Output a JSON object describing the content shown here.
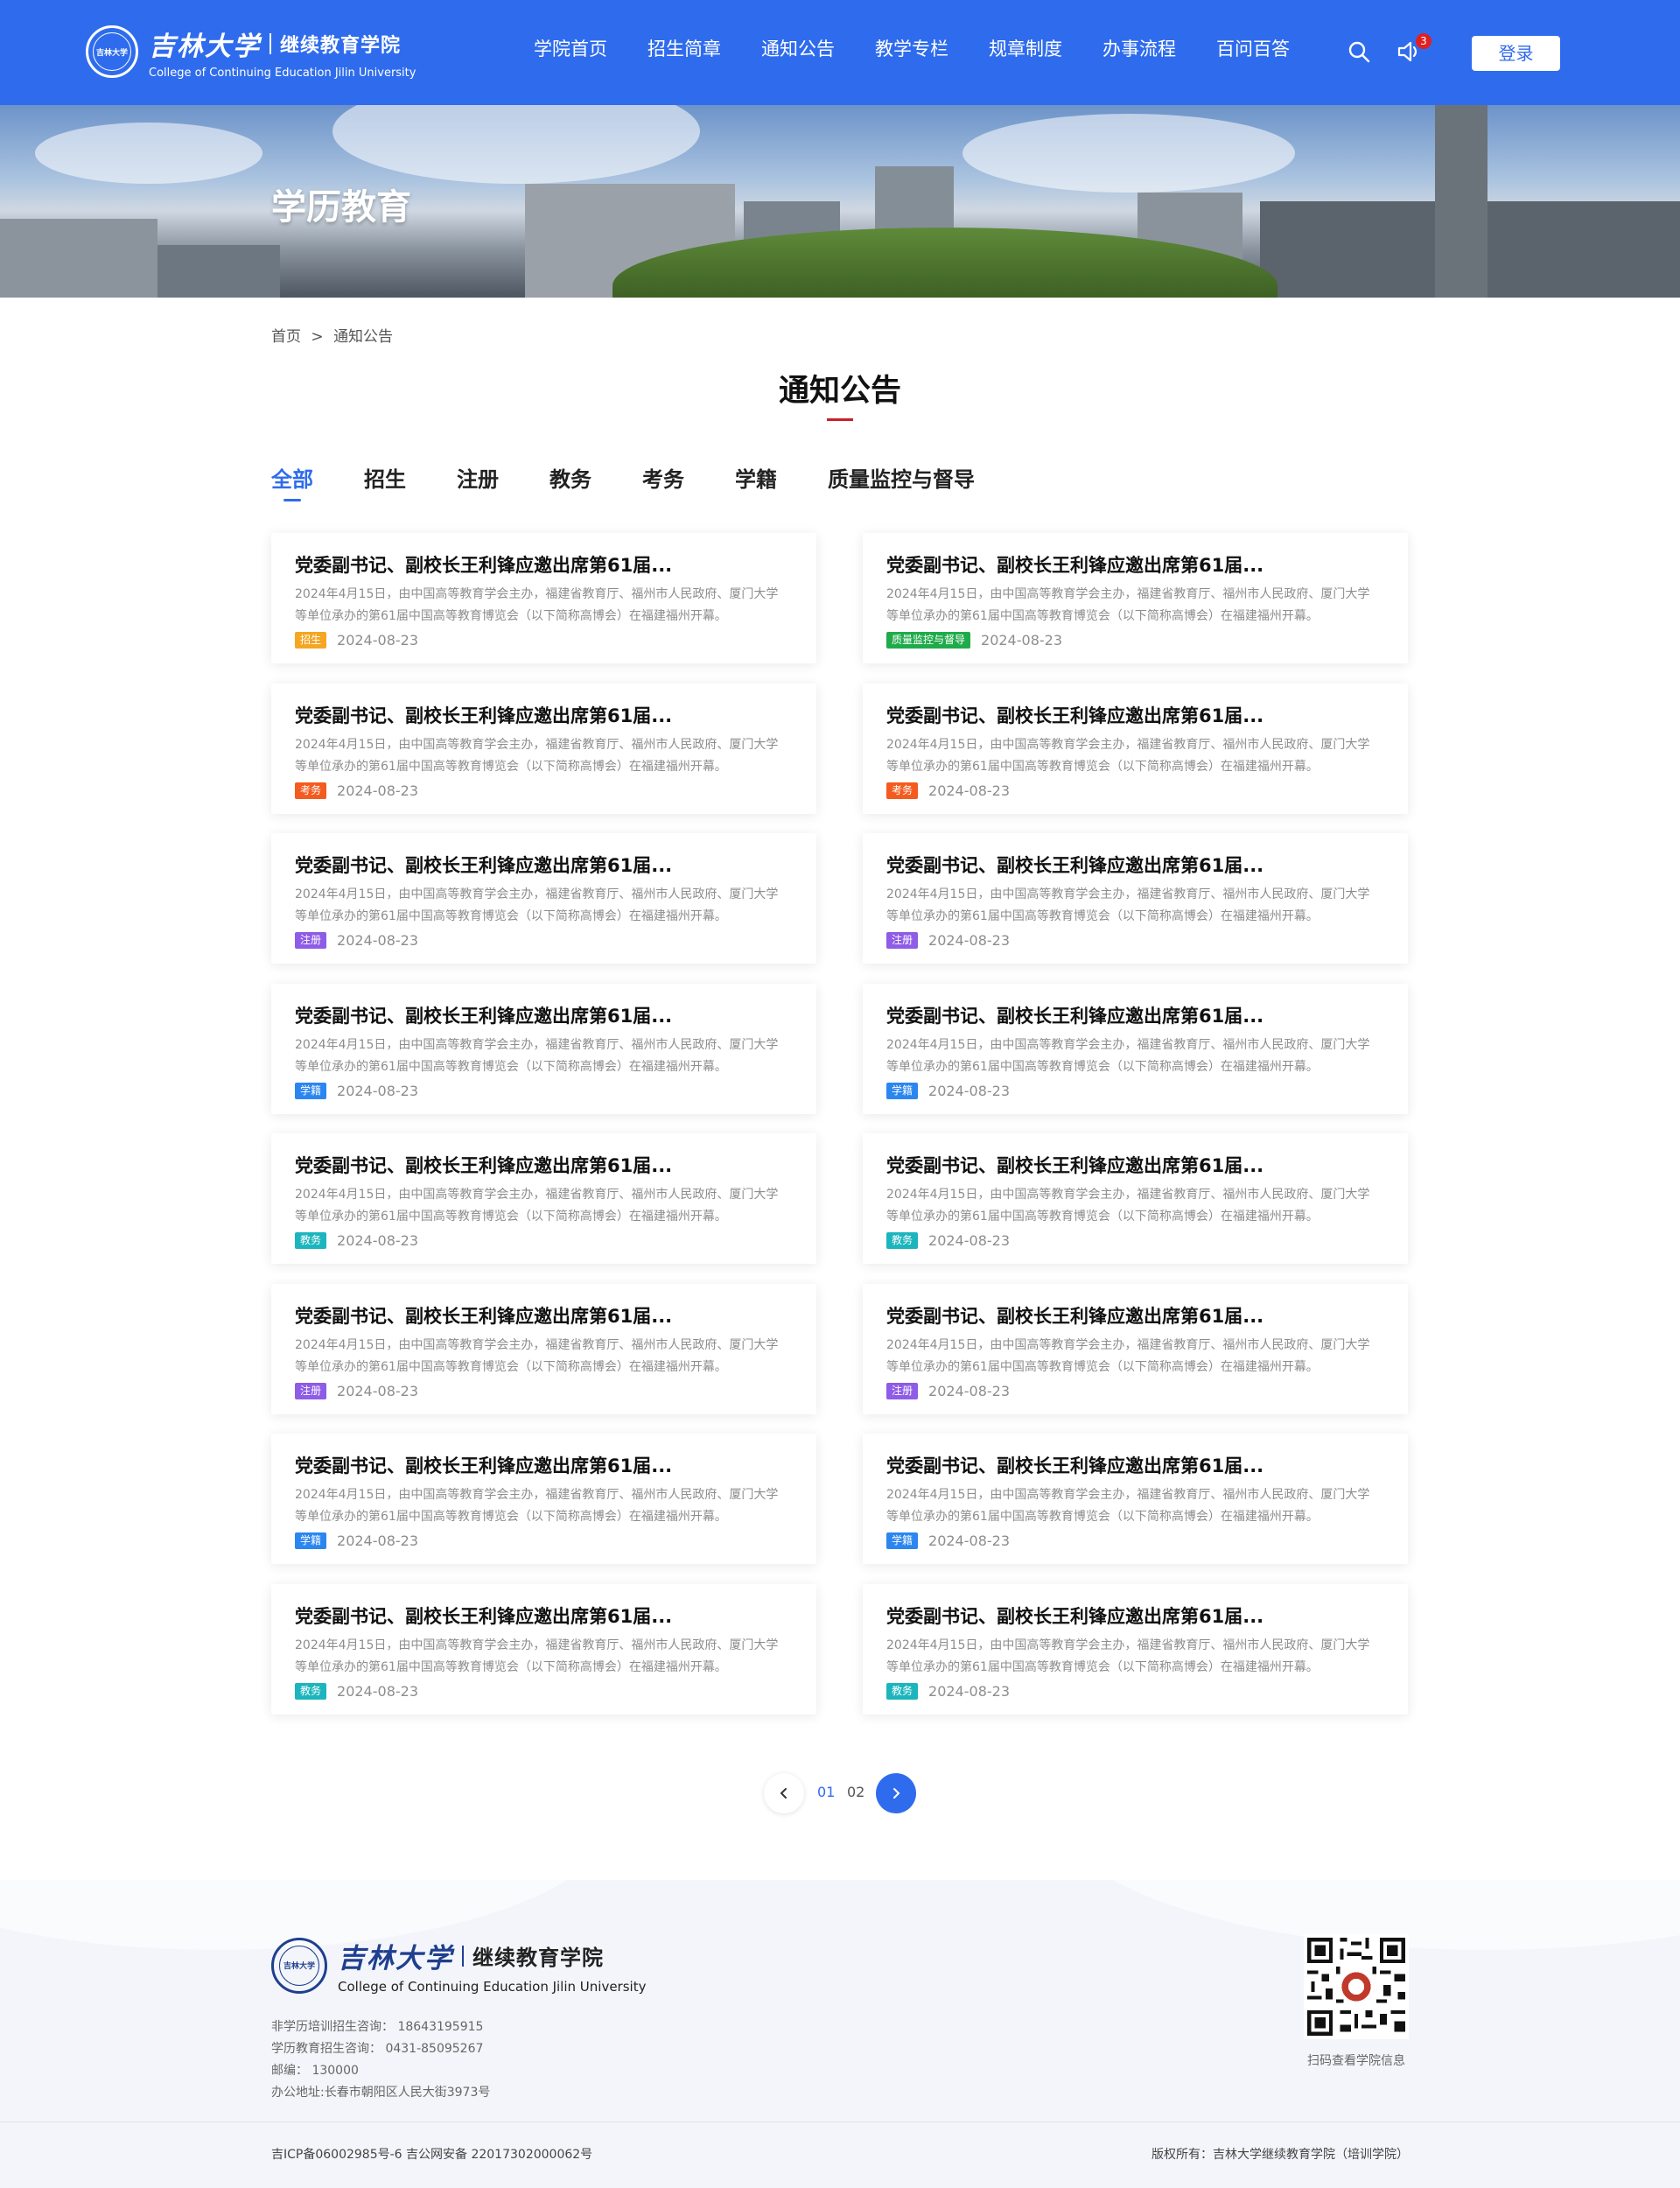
{
  "header": {
    "logo_cn": "吉林大学",
    "logo_college": "继续教育学院",
    "logo_en": "College of Continuing Education Jilin University",
    "nav": [
      "学院首页",
      "招生简章",
      "通知公告",
      "教学专栏",
      "规章制度",
      "办事流程",
      "百问百答"
    ],
    "notification_count": "3",
    "login_label": "登录"
  },
  "banner": {
    "title": "学历教育"
  },
  "breadcrumb": {
    "home": "首页",
    "separator": ">",
    "current": "通知公告"
  },
  "page_title": "通知公告",
  "tabs": [
    "全部",
    "招生",
    "注册",
    "教务",
    "考务",
    "学籍",
    "质量监控与督导"
  ],
  "active_tab": "全部",
  "tag_colors": {
    "招生": "#f5a623",
    "质量监控与督导": "#1fab4a",
    "考务": "#f45b1f",
    "注册": "#8e5ce6",
    "学籍": "#2b86f0",
    "教务": "#1cb5bd"
  },
  "cards": [
    {
      "title": "党委副书记、副校长王利锋应邀出席第61届...",
      "desc": "2024年4月15日，由中国高等教育学会主办，福建省教育厅、福州市人民政府、厦门大学等单位承办的第61届中国高等教育博览会（以下简称高博会）在福建福州开幕。",
      "tag": "招生",
      "date": "2024-08-23"
    },
    {
      "title": "党委副书记、副校长王利锋应邀出席第61届...",
      "desc": "2024年4月15日，由中国高等教育学会主办，福建省教育厅、福州市人民政府、厦门大学等单位承办的第61届中国高等教育博览会（以下简称高博会）在福建福州开幕。",
      "tag": "质量监控与督导",
      "date": "2024-08-23"
    },
    {
      "title": "党委副书记、副校长王利锋应邀出席第61届...",
      "desc": "2024年4月15日，由中国高等教育学会主办，福建省教育厅、福州市人民政府、厦门大学等单位承办的第61届中国高等教育博览会（以下简称高博会）在福建福州开幕。",
      "tag": "考务",
      "date": "2024-08-23"
    },
    {
      "title": "党委副书记、副校长王利锋应邀出席第61届...",
      "desc": "2024年4月15日，由中国高等教育学会主办，福建省教育厅、福州市人民政府、厦门大学等单位承办的第61届中国高等教育博览会（以下简称高博会）在福建福州开幕。",
      "tag": "考务",
      "date": "2024-08-23"
    },
    {
      "title": "党委副书记、副校长王利锋应邀出席第61届...",
      "desc": "2024年4月15日，由中国高等教育学会主办，福建省教育厅、福州市人民政府、厦门大学等单位承办的第61届中国高等教育博览会（以下简称高博会）在福建福州开幕。",
      "tag": "注册",
      "date": "2024-08-23"
    },
    {
      "title": "党委副书记、副校长王利锋应邀出席第61届...",
      "desc": "2024年4月15日，由中国高等教育学会主办，福建省教育厅、福州市人民政府、厦门大学等单位承办的第61届中国高等教育博览会（以下简称高博会）在福建福州开幕。",
      "tag": "注册",
      "date": "2024-08-23"
    },
    {
      "title": "党委副书记、副校长王利锋应邀出席第61届...",
      "desc": "2024年4月15日，由中国高等教育学会主办，福建省教育厅、福州市人民政府、厦门大学等单位承办的第61届中国高等教育博览会（以下简称高博会）在福建福州开幕。",
      "tag": "学籍",
      "date": "2024-08-23"
    },
    {
      "title": "党委副书记、副校长王利锋应邀出席第61届...",
      "desc": "2024年4月15日，由中国高等教育学会主办，福建省教育厅、福州市人民政府、厦门大学等单位承办的第61届中国高等教育博览会（以下简称高博会）在福建福州开幕。",
      "tag": "学籍",
      "date": "2024-08-23"
    },
    {
      "title": "党委副书记、副校长王利锋应邀出席第61届...",
      "desc": "2024年4月15日，由中国高等教育学会主办，福建省教育厅、福州市人民政府、厦门大学等单位承办的第61届中国高等教育博览会（以下简称高博会）在福建福州开幕。",
      "tag": "教务",
      "date": "2024-08-23"
    },
    {
      "title": "党委副书记、副校长王利锋应邀出席第61届...",
      "desc": "2024年4月15日，由中国高等教育学会主办，福建省教育厅、福州市人民政府、厦门大学等单位承办的第61届中国高等教育博览会（以下简称高博会）在福建福州开幕。",
      "tag": "教务",
      "date": "2024-08-23"
    },
    {
      "title": "党委副书记、副校长王利锋应邀出席第61届...",
      "desc": "2024年4月15日，由中国高等教育学会主办，福建省教育厅、福州市人民政府、厦门大学等单位承办的第61届中国高等教育博览会（以下简称高博会）在福建福州开幕。",
      "tag": "注册",
      "date": "2024-08-23"
    },
    {
      "title": "党委副书记、副校长王利锋应邀出席第61届...",
      "desc": "2024年4月15日，由中国高等教育学会主办，福建省教育厅、福州市人民政府、厦门大学等单位承办的第61届中国高等教育博览会（以下简称高博会）在福建福州开幕。",
      "tag": "注册",
      "date": "2024-08-23"
    },
    {
      "title": "党委副书记、副校长王利锋应邀出席第61届...",
      "desc": "2024年4月15日，由中国高等教育学会主办，福建省教育厅、福州市人民政府、厦门大学等单位承办的第61届中国高等教育博览会（以下简称高博会）在福建福州开幕。",
      "tag": "学籍",
      "date": "2024-08-23"
    },
    {
      "title": "党委副书记、副校长王利锋应邀出席第61届...",
      "desc": "2024年4月15日，由中国高等教育学会主办，福建省教育厅、福州市人民政府、厦门大学等单位承办的第61届中国高等教育博览会（以下简称高博会）在福建福州开幕。",
      "tag": "学籍",
      "date": "2024-08-23"
    },
    {
      "title": "党委副书记、副校长王利锋应邀出席第61届...",
      "desc": "2024年4月15日，由中国高等教育学会主办，福建省教育厅、福州市人民政府、厦门大学等单位承办的第61届中国高等教育博览会（以下简称高博会）在福建福州开幕。",
      "tag": "教务",
      "date": "2024-08-23"
    },
    {
      "title": "党委副书记、副校长王利锋应邀出席第61届...",
      "desc": "2024年4月15日，由中国高等教育学会主办，福建省教育厅、福州市人民政府、厦门大学等单位承办的第61届中国高等教育博览会（以下简称高博会）在福建福州开幕。",
      "tag": "教务",
      "date": "2024-08-23"
    }
  ],
  "pagination": {
    "pages": [
      "01",
      "02"
    ],
    "current": "01"
  },
  "footer": {
    "logo_cn": "吉林大学",
    "logo_college": "继续教育学院",
    "logo_en": "College of Continuing Education Jilin University",
    "info": [
      "非学历培训招生咨询： 18643195915",
      "学历教育招生咨询：  0431-85095267",
      "邮编：  130000",
      "办公地址:长春市朝阳区人民大街3973号"
    ],
    "qr_caption": "扫码查看学院信息",
    "icp": "吉ICP备06002985号-6    吉公网安备 22017302000062号",
    "copyright": "版权所有：吉林大学继续教育学院（培训学院）"
  },
  "icons": [
    "search-icon",
    "speaker-icon",
    "chevron-left-icon",
    "chevron-right-icon",
    "qr-code-icon",
    "university-seal"
  ]
}
